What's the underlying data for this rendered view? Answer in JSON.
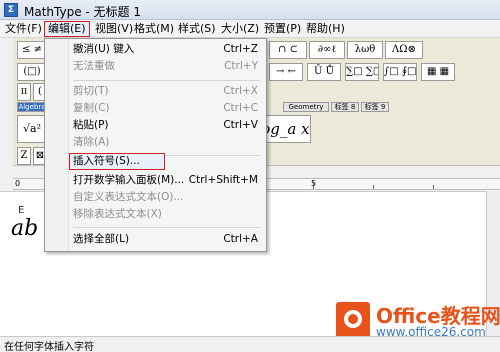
{
  "window": {
    "title": "MathType - 无标题 1",
    "app_icon": "Σ"
  },
  "menubar": {
    "items": [
      {
        "label": "文件(F)"
      },
      {
        "label": "编辑(E)"
      },
      {
        "label": "视图(V)"
      },
      {
        "label": "格式(M)"
      },
      {
        "label": "样式(S)"
      },
      {
        "label": "大小(Z)"
      },
      {
        "label": "预置(P)"
      },
      {
        "label": "帮助(H)"
      }
    ]
  },
  "toolbar": {
    "visible_buttons": {
      "row1_a": "≤ ≠",
      "row1_b": "∩ ⊂",
      "row1_c": "∂∞ℓ",
      "row1_d": "λωθ",
      "row1_e": "ΛΩ⊗",
      "row2_a": "(□)",
      "row2_b": "→ ⇄",
      "row2_c": "∴ ∀",
      "row2_d": "Ū Ů",
      "row2_e": "∑□ ∑□",
      "row2_f": "∫□ ∮□",
      "row2_g": "▭ ▭",
      "row2_h": "→ ←",
      "row2_i": "Ū Ů",
      "row2_j": "▦ ▦",
      "row3_a": "π",
      "row3_b": "(",
      "big_left": "√a²",
      "big_right": "log_a x",
      "row4_a": "Z",
      "row4_b": "⊠"
    },
    "tabs": [
      {
        "label": "Algebra"
      },
      {
        "label": "Geometry"
      },
      {
        "label": "标签 8"
      },
      {
        "label": "标签 9"
      }
    ]
  },
  "ruler": {
    "labels": [
      "0",
      "5"
    ]
  },
  "editor": {
    "content": "ab",
    "cursor_mark": "E"
  },
  "edit_menu": {
    "items": [
      {
        "label": "撤消(U) 键入",
        "shortcut": "Ctrl+Z",
        "disabled": false
      },
      {
        "label": "无法重做",
        "shortcut": "Ctrl+Y",
        "disabled": true
      },
      {
        "label": "剪切(T)",
        "shortcut": "Ctrl+X",
        "disabled": true
      },
      {
        "label": "复制(C)",
        "shortcut": "Ctrl+C",
        "disabled": true
      },
      {
        "label": "粘贴(P)",
        "shortcut": "Ctrl+V",
        "disabled": false
      },
      {
        "label": "清除(A)",
        "shortcut": "",
        "disabled": true
      },
      {
        "label": "插入符号(S)...",
        "shortcut": "",
        "disabled": false
      },
      {
        "label": "打开数学输入面板(M)...",
        "shortcut": "Ctrl+Shift+M",
        "disabled": false
      },
      {
        "label": "自定义表达式文本(O)...",
        "shortcut": "",
        "disabled": true
      },
      {
        "label": "移除表达式文本(X)",
        "shortcut": "",
        "disabled": true
      },
      {
        "label": "选择全部(L)",
        "shortcut": "Ctrl+A",
        "disabled": false
      }
    ]
  },
  "statusbar": {
    "text": "在任何字体插入字符"
  },
  "watermark": {
    "title": "Office教程网",
    "url": "www.office26.com"
  },
  "colors": {
    "highlight_border": "#d02020",
    "watermark_orange": "#e8531c",
    "watermark_blue": "#3a7ac4"
  }
}
